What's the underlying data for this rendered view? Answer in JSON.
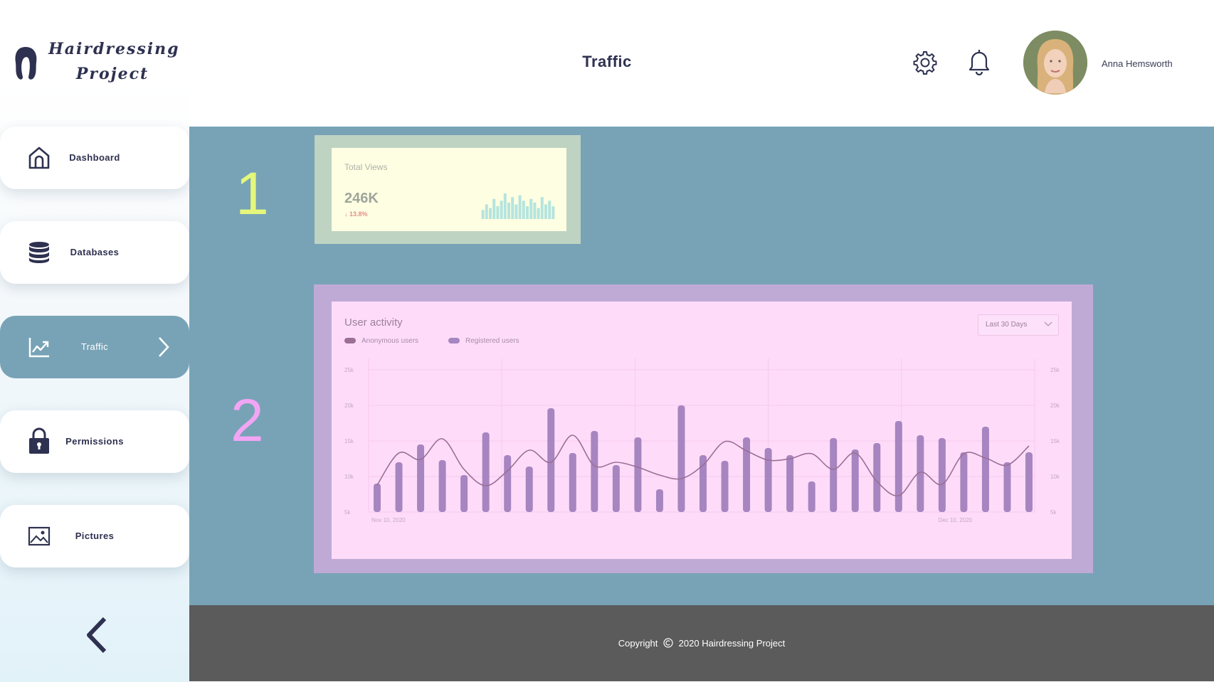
{
  "header": {
    "brand_line1": "Hairdressing",
    "brand_line2": "Project",
    "page_title": "Traffic",
    "user_name": "Anna Hemsworth",
    "icons": [
      "settings-gear-icon",
      "notification-bell-icon"
    ]
  },
  "sidebar": {
    "items": [
      {
        "label": "Dashboard",
        "icon": "home-icon"
      },
      {
        "label": "Databases",
        "icon": "database-icon"
      },
      {
        "label": "Traffic",
        "icon": "trend-chart-icon",
        "active": true
      },
      {
        "label": "Permissions",
        "icon": "lock-icon"
      },
      {
        "label": "Pictures",
        "icon": "image-icon"
      }
    ],
    "back_icon": "chevron-left-icon"
  },
  "main": {
    "step1": "1",
    "step2": "2",
    "total_views": {
      "label": "Total Views",
      "value": "246K",
      "delta": "↓ 13.8%",
      "spark_values": [
        5,
        8,
        6,
        11,
        7,
        10,
        14,
        9,
        12,
        8,
        13,
        10,
        7,
        11,
        9,
        6,
        12,
        8,
        10,
        7
      ]
    },
    "user_activity": {
      "title": "User activity",
      "range_select": "Last 30 Days",
      "colors": {
        "anonymous": "#9b6f96",
        "registered": "#a785c0"
      }
    }
  },
  "chart_data": {
    "type": "bar",
    "title": "User activity",
    "series": [
      {
        "name": "Registered users",
        "type": "bar",
        "values": [
          9,
          12,
          14.5,
          12.3,
          10.2,
          16.2,
          13,
          11.4,
          19.6,
          13.3,
          16.4,
          11.6,
          15.5,
          8.2,
          20,
          13,
          12.2,
          15.5,
          14,
          13,
          9.3,
          15.4,
          13.8,
          14.7,
          17.8,
          15.8,
          15.4,
          13.4,
          17,
          12,
          13.4
        ]
      },
      {
        "name": "Anonymous users",
        "type": "line",
        "values": [
          8.8,
          13.3,
          12.4,
          15.3,
          11.0,
          8.7,
          10.8,
          13.7,
          12.0,
          15.8,
          11.5,
          12.0,
          11.3,
          10.2,
          9.7,
          11.6,
          14.9,
          13.6,
          12.3,
          12.5,
          13.2,
          11.0,
          13.3,
          9.3,
          7.3,
          10.6,
          8.9,
          13.2,
          12.6,
          11.6,
          14.3
        ]
      }
    ],
    "x_start": "Nov 10, 2020",
    "x_end": "Dec 10, 2020",
    "y_ticks": [
      "25k",
      "20k",
      "15k",
      "10k",
      "5k"
    ],
    "ylim": [
      5,
      25
    ],
    "grid": true,
    "legend": "top-left"
  },
  "footer": {
    "copyright_prefix": "Copyright",
    "copyright_text": "2020 Hairdressing Project"
  }
}
